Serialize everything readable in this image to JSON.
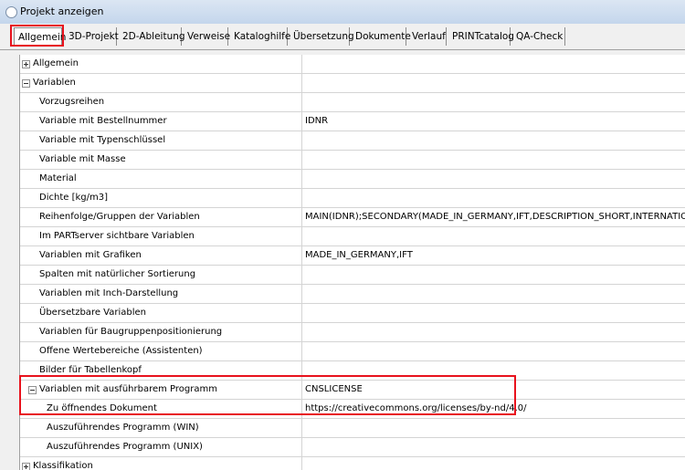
{
  "window": {
    "title": "Projekt anzeigen"
  },
  "tabs": [
    {
      "label": "Allgemein",
      "active": true
    },
    {
      "label": "3D-Projekt"
    },
    {
      "label": "2D-Ableitung"
    },
    {
      "label": "Verweise"
    },
    {
      "label": "Kataloghilfe"
    },
    {
      "label": "Übersetzung"
    },
    {
      "label": "Dokumente"
    },
    {
      "label": "Verlauf"
    },
    {
      "label": "PRINTcatalog"
    },
    {
      "label": "QA-Check"
    }
  ],
  "colors": {
    "highlight": "#e8121d",
    "titlebar": "#c4d6ec"
  },
  "rows": [
    {
      "label": "Allgemein",
      "value": "",
      "level": 0,
      "expander": "plus"
    },
    {
      "label": "Variablen",
      "value": "",
      "level": 0,
      "expander": "minus"
    },
    {
      "label": "Vorzugsreihen",
      "value": "",
      "level": 1
    },
    {
      "label": "Variable mit Bestellnummer",
      "value": "IDNR",
      "level": 1
    },
    {
      "label": "Variable mit Typenschlüssel",
      "value": "",
      "level": 1
    },
    {
      "label": "Variable mit Masse",
      "value": "",
      "level": 1
    },
    {
      "label": "Material",
      "value": "",
      "level": 1
    },
    {
      "label": "Dichte [kg/m3]",
      "value": "",
      "level": 1
    },
    {
      "label": "Reihenfolge/Gruppen der Variablen",
      "value": "MAIN(IDNR);SECONDARY(MADE_IN_GERMANY,IFT,DESCRIPTION_SHORT,INTERNATIONAL_PID",
      "level": 1
    },
    {
      "label": "Im PARTserver sichtbare Variablen",
      "value": "",
      "level": 1
    },
    {
      "label": "Variablen mit Grafiken",
      "value": "MADE_IN_GERMANY,IFT",
      "level": 1
    },
    {
      "label": "Spalten mit natürlicher Sortierung",
      "value": "",
      "level": 1
    },
    {
      "label": "Variablen mit Inch-Darstellung",
      "value": "",
      "level": 1
    },
    {
      "label": "Übersetzbare Variablen",
      "value": "",
      "level": 1
    },
    {
      "label": "Variablen für Baugruppenpositionierung",
      "value": "",
      "level": 1
    },
    {
      "label": "Offene Wertebereiche (Assistenten)",
      "value": "",
      "level": 1
    },
    {
      "label": "Bilder für Tabellenkopf",
      "value": "",
      "level": 1
    },
    {
      "label": "Variablen mit ausführbarem Programm",
      "value": "CNSLICENSE",
      "level": 1,
      "expander": "minus"
    },
    {
      "label": "Zu öffnendes Dokument",
      "value": "https://creativecommons.org/licenses/by-nd/4.0/",
      "level": 2
    },
    {
      "label": "Auszuführendes Programm (WIN)",
      "value": "",
      "level": 2
    },
    {
      "label": "Auszuführendes Programm (UNIX)",
      "value": "",
      "level": 2
    },
    {
      "label": "Klassifikation",
      "value": "",
      "level": 0,
      "expander": "plus"
    }
  ]
}
